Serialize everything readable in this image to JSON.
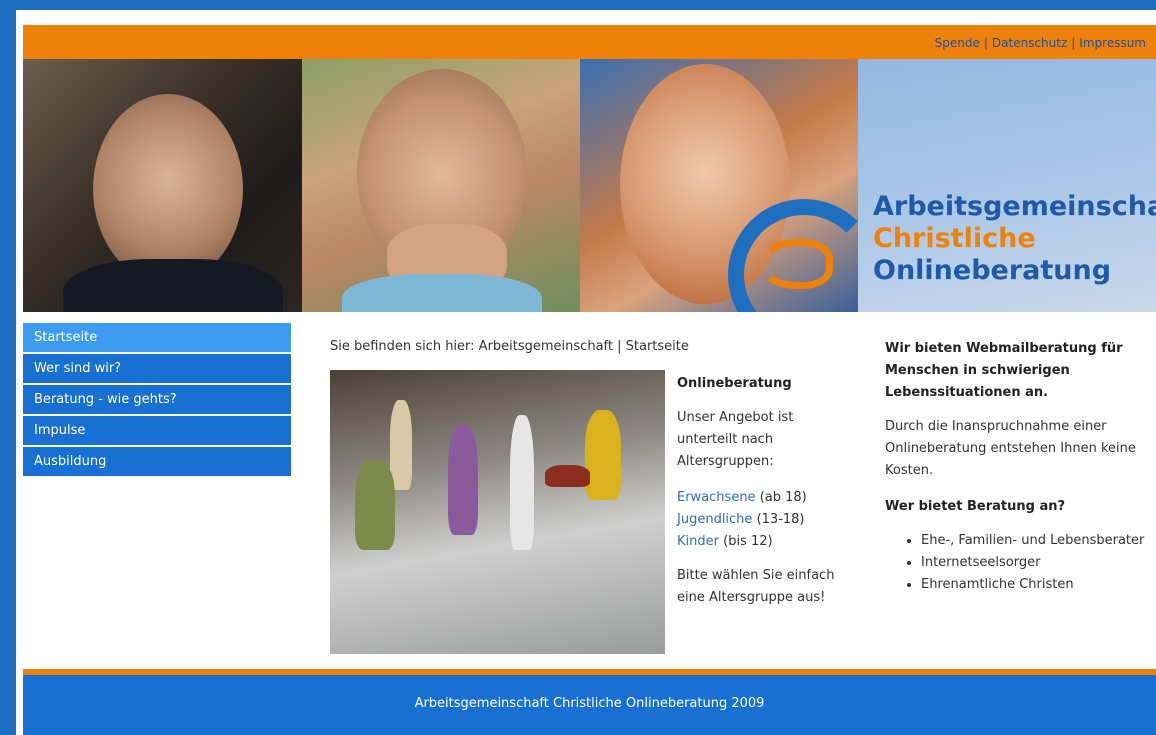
{
  "topbar": {
    "links": [
      "Spende",
      "Datenschutz",
      "Impressum"
    ],
    "separator": "|"
  },
  "logo": {
    "line1": "Arbeitsgemeinschaft",
    "line2": "Christliche",
    "line3": "Onlineberatung"
  },
  "nav": {
    "items": [
      "Startseite",
      "Wer sind wir?",
      "Beratung - wie gehts?",
      "Impulse",
      "Ausbildung"
    ],
    "active_index": 0
  },
  "breadcrumb": "Sie befinden sich hier: Arbeitsgemeinschaft | Startseite",
  "middle": {
    "heading": "Onlineberatung",
    "intro": "Unser Angebot ist unterteilt nach Altersgruppen:",
    "groups": [
      {
        "link": "Erwachsene",
        "range": "(ab 18)"
      },
      {
        "link": "Jugendliche",
        "range": "(13-18)"
      },
      {
        "link": "Kinder",
        "range": "(bis 12)"
      }
    ],
    "outro": "Bitte wählen Sie einfach eine Altersgruppe aus!"
  },
  "right": {
    "heading": "Wir bieten Webmailberatung für Menschen in schwierigen Lebenssituationen an.",
    "text": "Durch die Inanspruchnahme einer Onlineberatung entstehen Ihnen keine Kosten.",
    "subheading": "Wer bietet Beratung an?",
    "list": [
      "Ehe-, Familien- und Lebensberater",
      "Internetseelsorger",
      "Ehrenamtliche Christen"
    ]
  },
  "footer": "Arbeitsgemeinschaft Christliche Onlineberatung 2009",
  "colors": {
    "orange": "#ee8209",
    "blue": "#1870d2",
    "nav_active": "#3b9cf0",
    "link": "#2e6fb5"
  }
}
